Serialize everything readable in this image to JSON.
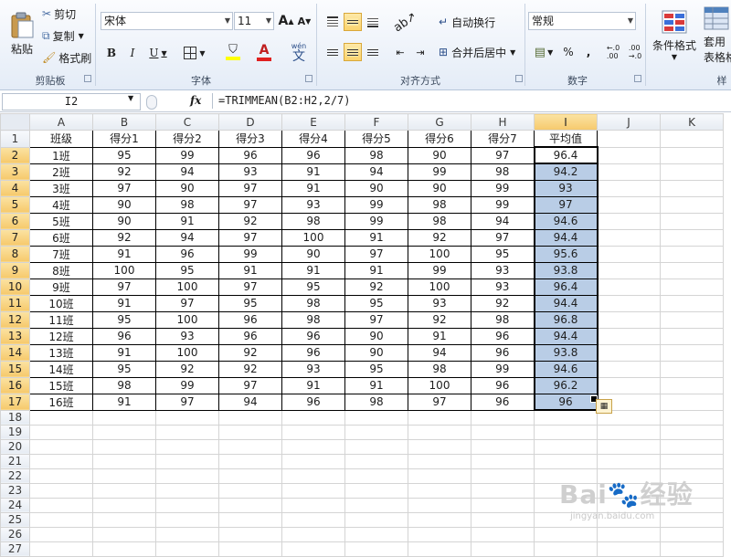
{
  "ribbon": {
    "clipboard": {
      "label": "剪贴板",
      "paste": "粘贴",
      "cut": "剪切",
      "copy": "复制",
      "format_painter": "格式刷"
    },
    "font": {
      "label": "字体",
      "font_name": "宋体",
      "font_size": "11",
      "bold": "B",
      "italic": "I",
      "underline": "U",
      "grow": "A",
      "shrink": "A",
      "font_color_letter": "A",
      "phonetic": "wén"
    },
    "alignment": {
      "label": "对齐方式",
      "wrap_text": "自动换行",
      "merge_center": "合并后居中"
    },
    "number": {
      "label": "数字",
      "format": "常规",
      "percent": "%",
      "comma": ","
    },
    "styles": {
      "conditional_format": "条件格式",
      "table_format_1": "套用",
      "table_format_2": "表格格",
      "label_partial": "样"
    },
    "colors": {
      "accent_selected": "#b9cde6",
      "ribbon_bg": "#e4ecf7",
      "active_button": "#fbd46e",
      "font_color_bar": "#e02020",
      "highlight_bar": "#ffff00"
    }
  },
  "formula_bar": {
    "name_box": "I2",
    "fx_label": "fx",
    "formula": "=TRIMMEAN(B2:H2,2/7)"
  },
  "sheet": {
    "columns": [
      "A",
      "B",
      "C",
      "D",
      "E",
      "F",
      "G",
      "H",
      "I",
      "J",
      "K"
    ],
    "row_numbers": [
      "1",
      "2",
      "3",
      "4",
      "5",
      "6",
      "7",
      "8",
      "9",
      "10",
      "11",
      "12",
      "13",
      "14",
      "15",
      "16",
      "17",
      "18",
      "19",
      "20",
      "21",
      "22",
      "23",
      "24",
      "25",
      "26",
      "27"
    ],
    "headers": [
      "班级",
      "得分1",
      "得分2",
      "得分3",
      "得分4",
      "得分5",
      "得分6",
      "得分7",
      "平均值"
    ],
    "rows": [
      [
        "1班",
        "95",
        "99",
        "96",
        "96",
        "98",
        "90",
        "97",
        "96.4"
      ],
      [
        "2班",
        "92",
        "94",
        "93",
        "91",
        "94",
        "99",
        "98",
        "94.2"
      ],
      [
        "3班",
        "97",
        "90",
        "97",
        "91",
        "90",
        "90",
        "99",
        "93"
      ],
      [
        "4班",
        "90",
        "98",
        "97",
        "93",
        "99",
        "98",
        "99",
        "97"
      ],
      [
        "5班",
        "90",
        "91",
        "92",
        "98",
        "99",
        "98",
        "94",
        "94.6"
      ],
      [
        "6班",
        "92",
        "94",
        "97",
        "100",
        "91",
        "92",
        "97",
        "94.4"
      ],
      [
        "7班",
        "91",
        "96",
        "99",
        "90",
        "97",
        "100",
        "95",
        "95.6"
      ],
      [
        "8班",
        "100",
        "95",
        "91",
        "91",
        "91",
        "99",
        "93",
        "93.8"
      ],
      [
        "9班",
        "97",
        "100",
        "97",
        "95",
        "92",
        "100",
        "93",
        "96.4"
      ],
      [
        "10班",
        "91",
        "97",
        "95",
        "98",
        "95",
        "93",
        "92",
        "94.4"
      ],
      [
        "11班",
        "95",
        "100",
        "96",
        "98",
        "97",
        "92",
        "98",
        "96.8"
      ],
      [
        "12班",
        "96",
        "93",
        "96",
        "96",
        "90",
        "91",
        "96",
        "94.4"
      ],
      [
        "13班",
        "91",
        "100",
        "92",
        "96",
        "90",
        "94",
        "96",
        "93.8"
      ],
      [
        "14班",
        "95",
        "92",
        "92",
        "93",
        "95",
        "98",
        "99",
        "94.6"
      ],
      [
        "15班",
        "98",
        "99",
        "97",
        "91",
        "91",
        "100",
        "96",
        "96.2"
      ],
      [
        "16班",
        "91",
        "97",
        "94",
        "96",
        "98",
        "97",
        "96",
        "96"
      ]
    ],
    "selected_column": "I",
    "active_cell": "I2"
  }
}
